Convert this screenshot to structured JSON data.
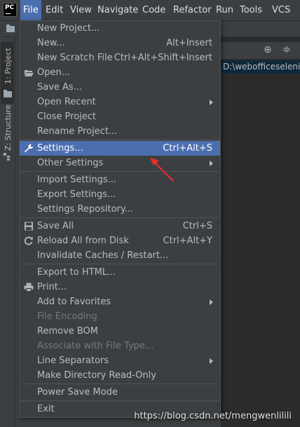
{
  "app": {
    "logo_text": "PC"
  },
  "menubar": {
    "items": [
      {
        "label": "File",
        "active": true
      },
      {
        "label": "Edit"
      },
      {
        "label": "View"
      },
      {
        "label": "Navigate"
      },
      {
        "label": "Code"
      },
      {
        "label": "Refactor"
      },
      {
        "label": "Run"
      },
      {
        "label": "Tools"
      },
      {
        "label": "VCS"
      }
    ]
  },
  "side_tabs": {
    "project": "1: Project",
    "structure": "Z: Structure"
  },
  "editor": {
    "path": "D:\\webofficeseleniu"
  },
  "file_menu": {
    "items": [
      {
        "label": "New Project...",
        "shortcut": ""
      },
      {
        "label": "New...",
        "shortcut": "Alt+Insert"
      },
      {
        "label": "New Scratch File",
        "shortcut": "Ctrl+Alt+Shift+Insert"
      },
      {
        "label": "Open...",
        "shortcut": "",
        "icon": "folder-open-icon"
      },
      {
        "label": "Save As...",
        "shortcut": ""
      },
      {
        "label": "Open Recent",
        "shortcut": "",
        "submenu": true
      },
      {
        "label": "Close Project",
        "shortcut": ""
      },
      {
        "label": "Rename Project...",
        "shortcut": ""
      },
      {
        "label": "Settings...",
        "shortcut": "Ctrl+Alt+S",
        "icon": "wrench-icon",
        "selected": true
      },
      {
        "label": "Other Settings",
        "shortcut": "",
        "submenu": true
      },
      {
        "label": "Import Settings...",
        "shortcut": ""
      },
      {
        "label": "Export Settings...",
        "shortcut": ""
      },
      {
        "label": "Settings Repository...",
        "shortcut": ""
      },
      {
        "label": "Save All",
        "shortcut": "Ctrl+S",
        "icon": "save-icon"
      },
      {
        "label": "Reload All from Disk",
        "shortcut": "Ctrl+Alt+Y",
        "icon": "reload-icon"
      },
      {
        "label": "Invalidate Caches / Restart...",
        "shortcut": ""
      },
      {
        "label": "Export to HTML...",
        "shortcut": ""
      },
      {
        "label": "Print...",
        "shortcut": "",
        "icon": "printer-icon"
      },
      {
        "label": "Add to Favorites",
        "shortcut": "",
        "submenu": true
      },
      {
        "label": "File Encoding",
        "shortcut": "",
        "disabled": true
      },
      {
        "label": "Remove BOM",
        "shortcut": ""
      },
      {
        "label": "Associate with File Type...",
        "shortcut": "",
        "disabled": true
      },
      {
        "label": "Line Separators",
        "shortcut": "",
        "submenu": true
      },
      {
        "label": "Make Directory Read-Only",
        "shortcut": ""
      },
      {
        "label": "Power Save Mode",
        "shortcut": ""
      },
      {
        "label": "Exit",
        "shortcut": ""
      }
    ]
  },
  "colors": {
    "selection": "#4b6eaf",
    "annotation_arrow": "#e0312c"
  },
  "watermark": "https://blog.csdn.net/mengwenlilili"
}
